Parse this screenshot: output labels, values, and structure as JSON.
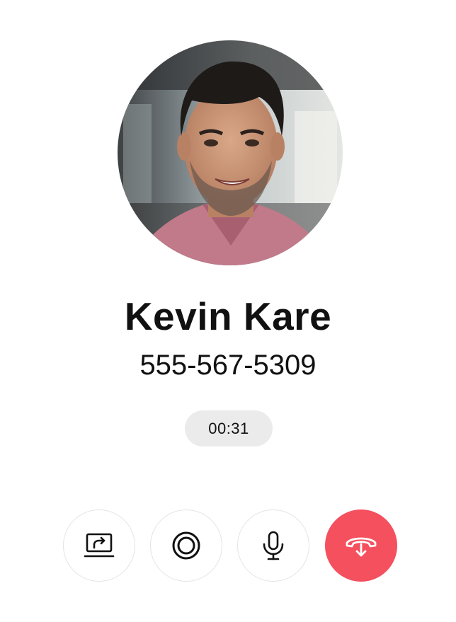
{
  "call": {
    "name": "Kevin Kare",
    "number": "555-567-5309",
    "timer": "00:31"
  },
  "controls": [
    {
      "icon": "screen-share-icon"
    },
    {
      "icon": "record-icon"
    },
    {
      "icon": "microphone-icon"
    },
    {
      "icon": "end-call-icon"
    }
  ],
  "colors": {
    "end_call": "#f4505e",
    "timer_bg": "#ebebeb",
    "text": "#111111"
  }
}
